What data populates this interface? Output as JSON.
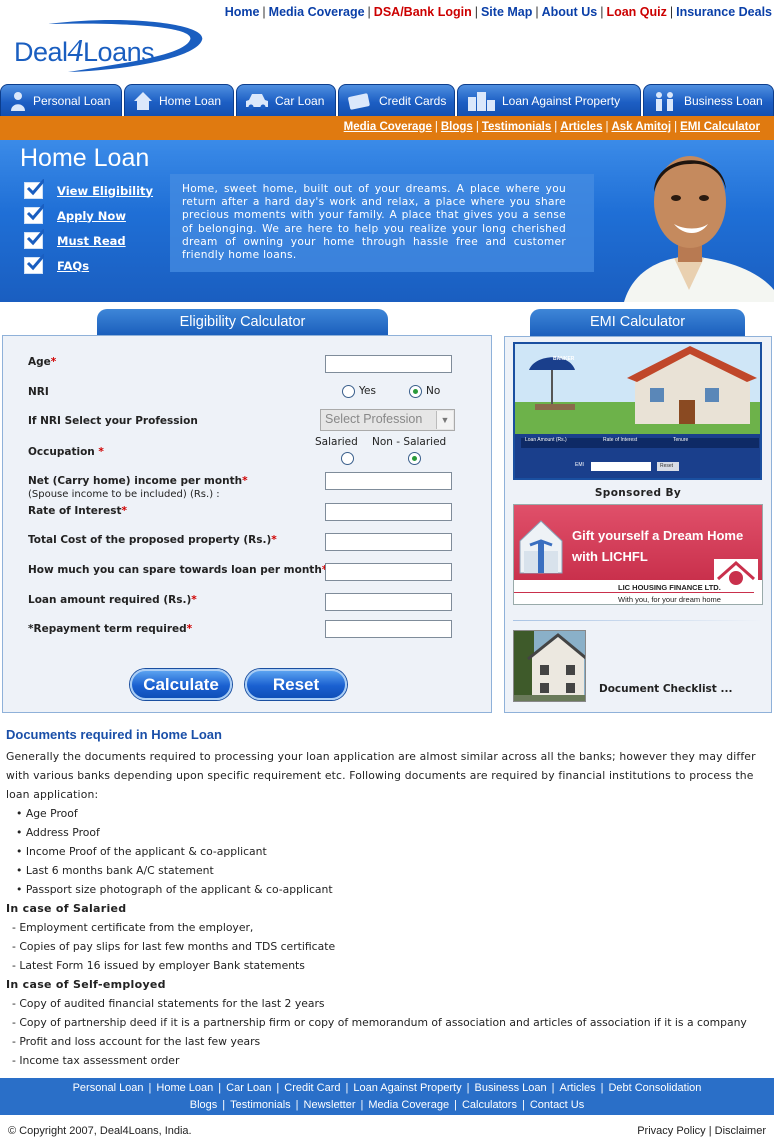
{
  "top_nav": [
    {
      "label": "Home",
      "red": false
    },
    {
      "label": "Media Coverage",
      "red": false
    },
    {
      "label": "DSA/Bank Login",
      "red": true
    },
    {
      "label": "Site Map",
      "red": false
    },
    {
      "label": "About Us",
      "red": false
    },
    {
      "label": "Loan Quiz",
      "red": true
    },
    {
      "label": "Insurance Deals",
      "red": false
    }
  ],
  "logo": {
    "text_left": "Deal",
    "text_mid": "4",
    "text_right": "Loans"
  },
  "tabs": [
    "Personal Loan",
    "Home Loan",
    "Car Loan",
    "Credit Cards",
    "Loan Against Property",
    "Business Loan"
  ],
  "sub_links": [
    "Media Coverage",
    "Blogs",
    "Testimonials",
    "Articles",
    "Ask Amitoj",
    "EMI Calculator"
  ],
  "hero": {
    "title": "Home Loan",
    "links": [
      "View Eligibility",
      "Apply Now",
      "Must Read",
      "FAQs"
    ],
    "text": "Home, sweet home, built out of your dreams. A place where you return after a hard day's work and relax, a place where you share precious moments with your family. A place that gives you a sense of belonging. We are here to help you realize your long cherished dream of owning your home through hassle free and customer friendly home loans."
  },
  "eligibility": {
    "heading": "Eligibility Calculator",
    "age": "Age",
    "nri": "NRI",
    "nri_yes": "Yes",
    "nri_no": "No",
    "nri_profession": "If NRI Select your Profession",
    "profession_placeholder": "Select Profession",
    "occupation": "Occupation",
    "salaried": "Salaried",
    "non_salaried": "Non - Salaried",
    "net_income": "Net (Carry home) income per month",
    "net_income_sub": "(Spouse income to be included) (Rs.) :",
    "rate": "Rate of Interest",
    "total_cost": "Total Cost of the proposed property (Rs.)",
    "spare": "How much you can spare towards loan per month",
    "loan_amount": "Loan amount required (Rs.)",
    "repayment": "*Repayment term required",
    "star": "*",
    "calculate": "Calculate",
    "reset": "Reset"
  },
  "emi": {
    "heading": "EMI Calculator",
    "banner_umbrella": "BANKER",
    "banner_loan_amount": "Loan Amount (Rs.)",
    "banner_rate": "Rate of Interest",
    "banner_tenure": "Tenure",
    "banner_emi": "EMI",
    "banner_reset": "Reset",
    "sponsored": "Sponsored By",
    "ad_title_1": "Gift yourself a Dream Home",
    "ad_title_2": "with LICHFL",
    "ad_company": "LIC HOUSING FINANCE LTD.",
    "ad_tagline": "With you, for your dream home",
    "checklist": "Document Checklist ..."
  },
  "docs": {
    "heading": "Documents required in Home Loan",
    "intro": "Generally the documents required to processing your loan application are   almost similar across all the banks; however they may differ with various banks depending upon specific requirement etc. Following documents are required by financial institutions to process the loan application:",
    "bullets": [
      "Age Proof",
      "Address Proof",
      "Income Proof of the applicant & co-applicant",
      "Last 6 months bank A/C statement",
      "Passport size photograph of the applicant & co-applicant"
    ],
    "salaried_heading": "In case of Salaried",
    "salaried": [
      "Employment certificate from the employer,",
      "Copies of pay slips for last few months and TDS certificate",
      "Latest Form 16 issued by employer Bank statements"
    ],
    "self_heading": "In case of Self-employed",
    "self": [
      "Copy of audited financial statements for the last 2 years",
      "Copy of partnership deed if it is a partnership firm or copy of memorandum of association and articles of association if it is a company",
      "Profit and loss account for the last few years",
      "Income tax assessment order"
    ]
  },
  "footer": {
    "row1": [
      "Personal Loan",
      "Home Loan",
      "Car Loan",
      "Credit Card",
      "Loan Against Property",
      "Business Loan",
      "Articles",
      "Debt Consolidation"
    ],
    "row2": [
      "Blogs",
      "Testimonials",
      "Newsletter",
      "Media Coverage",
      "Calculators",
      "Contact Us"
    ],
    "copyright": "© Copyright 2007, Deal4Loans, India.",
    "privacy": "Privacy Policy",
    "disclaimer": "Disclaimer"
  },
  "colors": {
    "brand_blue": "#1a5ec0",
    "accent_orange": "#e07a10",
    "link_red": "#cc0000",
    "required_star": "#d00000"
  }
}
